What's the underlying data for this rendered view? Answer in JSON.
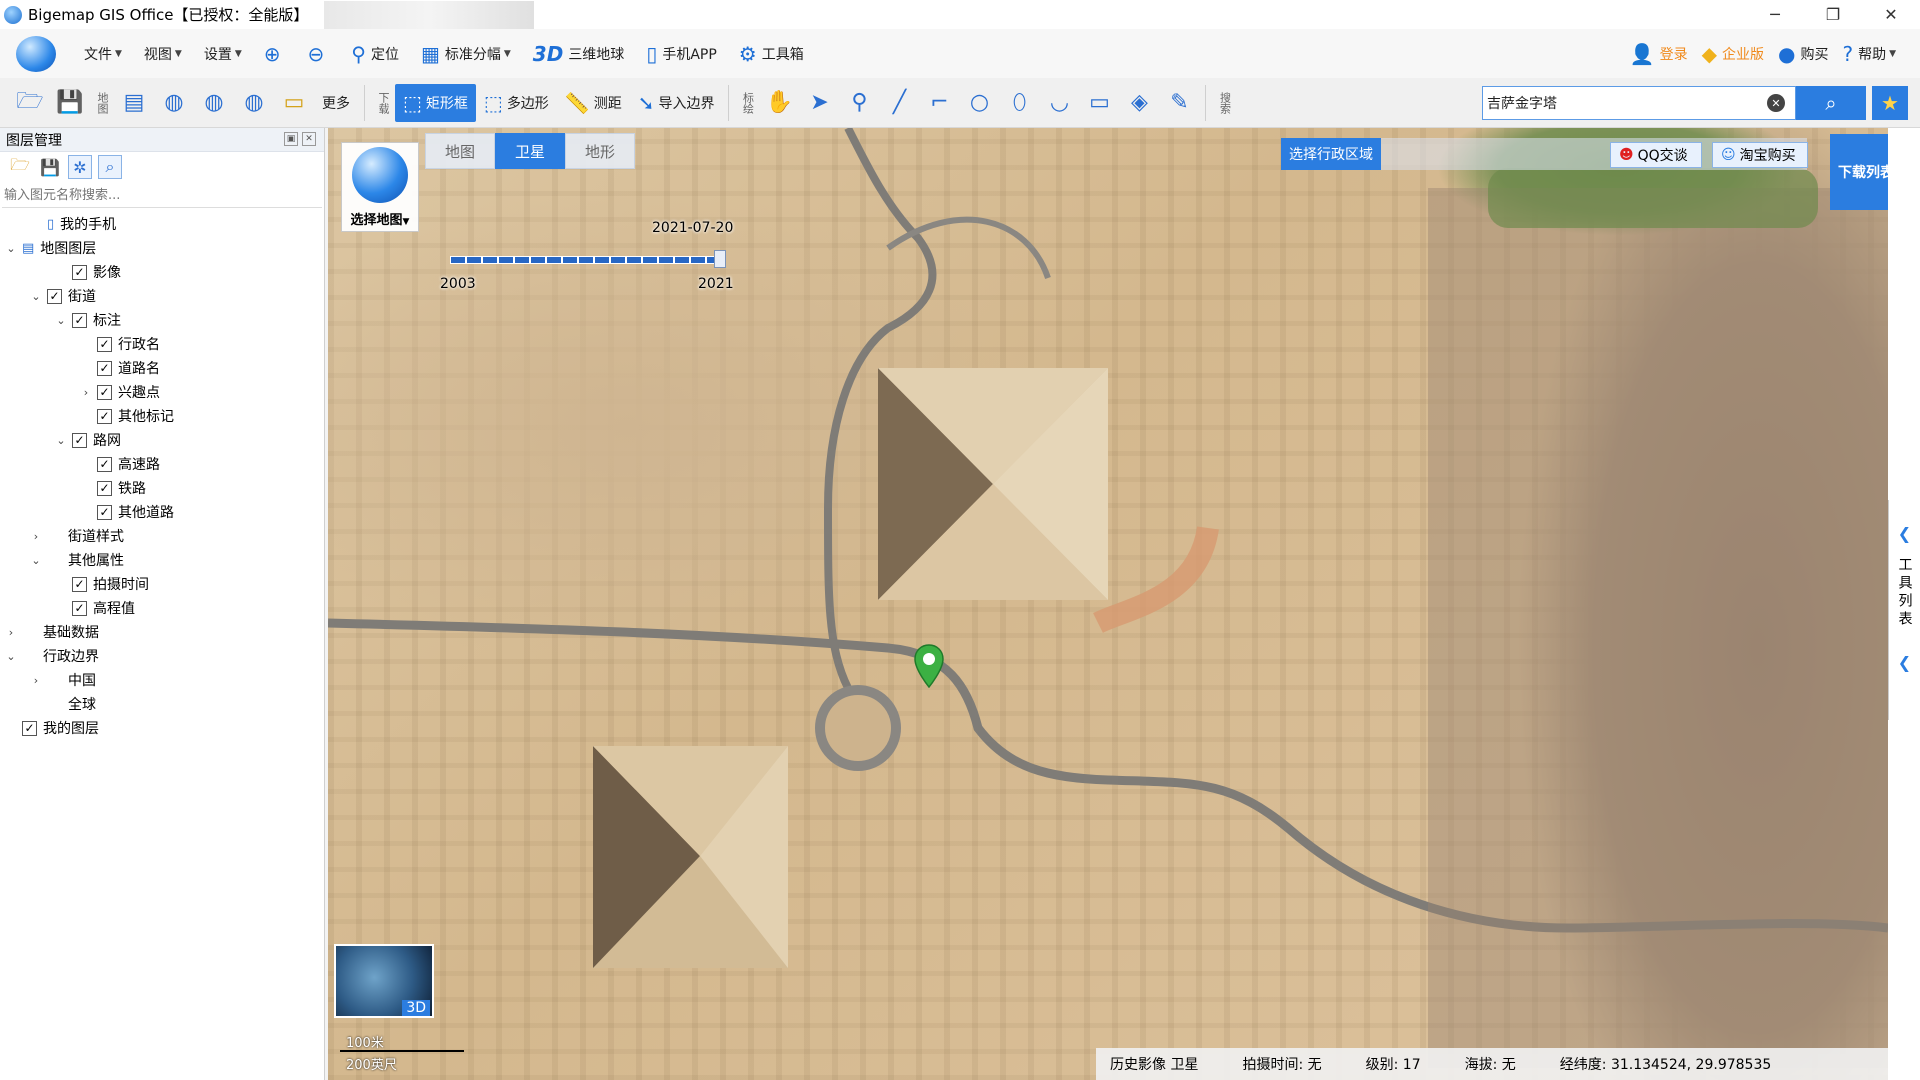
{
  "window": {
    "title": "Bigemap GIS Office【已授权：全能版】",
    "controls": {
      "minimize": "─",
      "restore": "❐",
      "close": "✕"
    }
  },
  "menu": {
    "file": "文件",
    "view": "视图",
    "settings": "设置",
    "locate": "定位",
    "sheet": "标准分幅",
    "globe_3d_badge": "3D",
    "globe_3d": "三维地球",
    "mobile_app": "手机APP",
    "toolbox": "工具箱",
    "login": "登录",
    "enterprise": "企业版",
    "buy": "购买",
    "help": "帮助"
  },
  "toolbar2": {
    "map_label": "地图",
    "more": "更多",
    "download_label": "下载",
    "rect": "矩形框",
    "polygon": "多边形",
    "measure": "测距",
    "import_boundary": "导入边界",
    "mark_label": "标绘",
    "search_label": "搜索"
  },
  "search": {
    "value": "吉萨金字塔"
  },
  "layer_panel": {
    "title": "图层管理",
    "search_placeholder": "输入图元名称搜索...",
    "tree": [
      {
        "label": "我的手机",
        "level": 1,
        "icon": "phone"
      },
      {
        "label": "地图图层",
        "level": 0,
        "arrow": "expanded",
        "icon": "layers"
      },
      {
        "label": "影像",
        "level": 2,
        "checked": true
      },
      {
        "label": "街道",
        "level": 1,
        "arrow": "expanded",
        "checked": true
      },
      {
        "label": "标注",
        "level": 2,
        "arrow": "expanded",
        "checked": true
      },
      {
        "label": "行政名",
        "level": 3,
        "checked": true
      },
      {
        "label": "道路名",
        "level": 3,
        "checked": true
      },
      {
        "label": "兴趣点",
        "level": 3,
        "arrow": "collapsed",
        "checked": true
      },
      {
        "label": "其他标记",
        "level": 3,
        "checked": true
      },
      {
        "label": "路网",
        "level": 2,
        "arrow": "expanded",
        "checked": true
      },
      {
        "label": "高速路",
        "level": 3,
        "checked": true
      },
      {
        "label": "铁路",
        "level": 3,
        "checked": true
      },
      {
        "label": "其他道路",
        "level": 3,
        "checked": true
      },
      {
        "label": "街道样式",
        "level": 1,
        "arrow": "collapsed"
      },
      {
        "label": "其他属性",
        "level": 1,
        "arrow": "expanded"
      },
      {
        "label": "拍摄时间",
        "level": 2,
        "checked": true
      },
      {
        "label": "高程值",
        "level": 2,
        "checked": true
      },
      {
        "label": "基础数据",
        "level": 0,
        "arrow": "collapsed"
      },
      {
        "label": "行政边界",
        "level": 0,
        "arrow": "expanded"
      },
      {
        "label": "中国",
        "level": 1,
        "arrow": "collapsed"
      },
      {
        "label": "全球",
        "level": 1
      },
      {
        "label": "我的图层",
        "level": 0,
        "checked": true
      }
    ]
  },
  "map": {
    "tabs": [
      "地图",
      "卫星",
      "地形"
    ],
    "active_tab": "卫星",
    "select_map": "选择地图",
    "timeline": {
      "current_date": "2021-07-20",
      "start_year": "2003",
      "end_year": "2021"
    },
    "select_admin_region": "选择行政区域",
    "qq_chat": "QQ交谈",
    "taobao_buy": "淘宝购买",
    "download_list": "下载列表",
    "tool_list": "工具列表",
    "view_3d": "3D",
    "scale_metric": "100米",
    "scale_imperial": "200英尺"
  },
  "status": {
    "imagery": "历史影像 卫星",
    "capture_time": "拍摄时间: 无",
    "level": "级别:  17",
    "altitude": "海拔: 无",
    "coords": "经纬度:  31.134524, 29.978535"
  },
  "colors": {
    "accent": "#2b7de0",
    "marker": "#3cb043"
  }
}
